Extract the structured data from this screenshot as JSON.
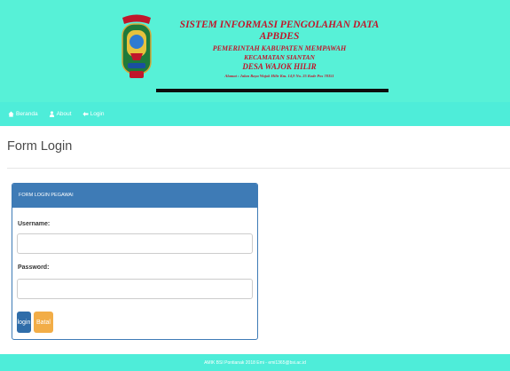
{
  "header": {
    "title": "SISTEM INFORMASI PENGOLAHAN DATA APBDES",
    "line2": "PEMERINTAH KABUPATEN MEMPAWAH",
    "line3": "KECAMATAN SIANTAN",
    "line4": "DESA WAJOK HILIR",
    "address": "Alamat : Jalan Raya Wajok Hilir Km. 14,9 No. 25 Kode Pos 78351",
    "logo_icon": "regency-crest-icon"
  },
  "nav": {
    "items": [
      {
        "label": "Beranda",
        "icon": "home-icon"
      },
      {
        "label": "About",
        "icon": "user-icon"
      },
      {
        "label": "Login",
        "icon": "login-icon"
      }
    ]
  },
  "page": {
    "title": "Form Login"
  },
  "form": {
    "panel_title": "FORM LOGIN PEGAWAI",
    "username_label": "Username:",
    "username_value": "",
    "password_label": "Password:",
    "password_value": "",
    "login_button": "login",
    "cancel_button": "Batal"
  },
  "footer": {
    "text": "AMIK BSI Pontianak 2018 Emi - emi1365@bsi.ac.id"
  },
  "colors": {
    "header_bg": "#57f1d7",
    "nav_bg": "#4eedd9",
    "header_text": "#c0172b",
    "panel_accent": "#3e7bb6",
    "cancel_button": "#f2ad47"
  }
}
